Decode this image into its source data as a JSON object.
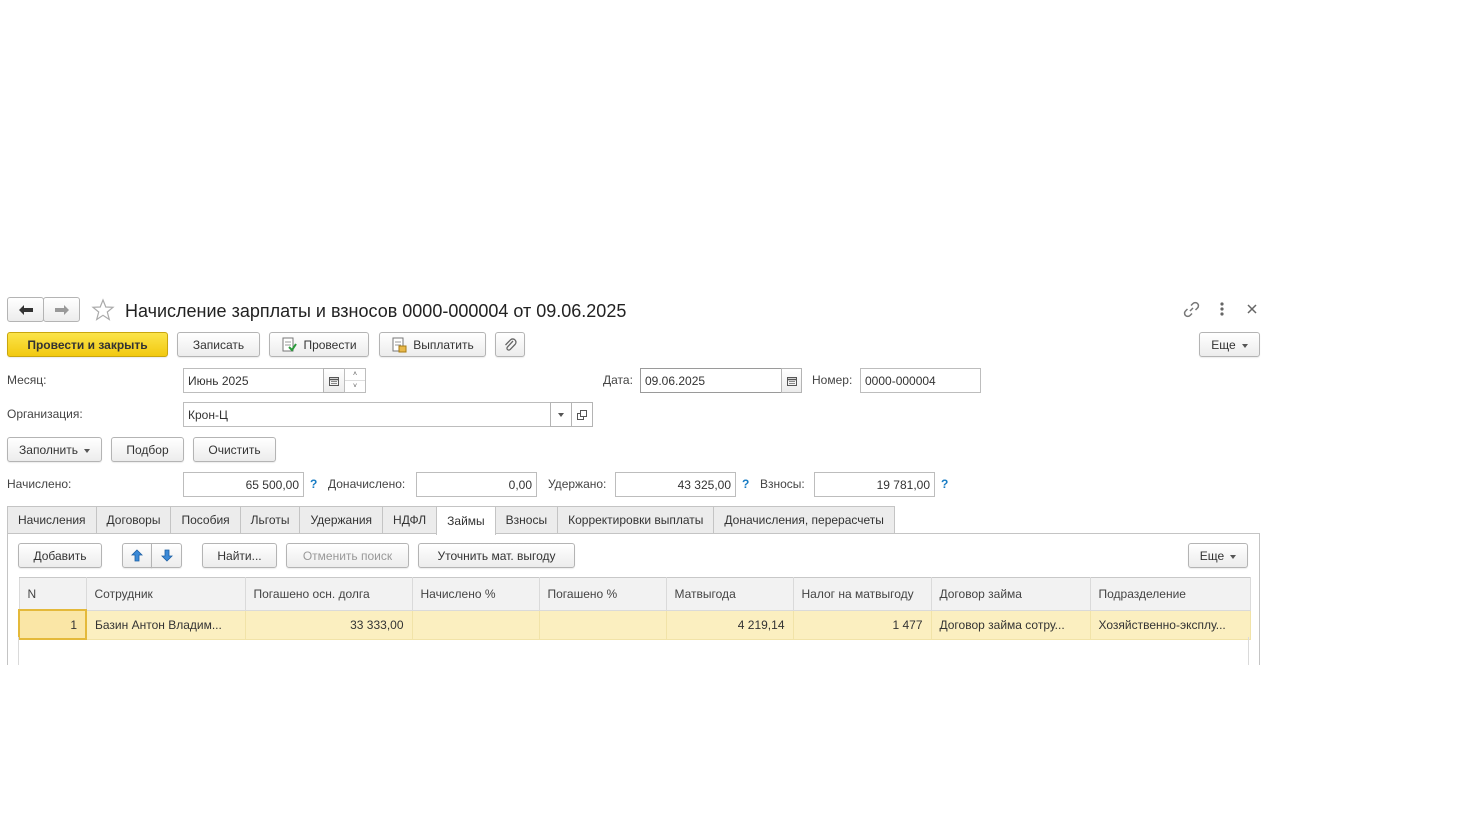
{
  "window": {
    "title": "Начисление зарплаты и взносов 0000-000004 от 09.06.2025",
    "nav_back_icon": "arrow-left-icon",
    "nav_forward_icon": "arrow-right-icon",
    "favorite_icon": "star-icon",
    "link_icon": "link-icon",
    "menu_icon": "more-vertical-icon",
    "close_icon": "close-icon"
  },
  "toolbar": {
    "post_close": "Провести и закрыть",
    "save": "Записать",
    "post": "Провести",
    "pay": "Выплатить",
    "attach_icon": "paperclip-icon",
    "more": "Еще"
  },
  "form": {
    "month_label": "Месяц:",
    "month_value": "Июнь 2025",
    "date_label": "Дата:",
    "date_value": "09.06.2025",
    "number_label": "Номер:",
    "number_value": "0000-000004",
    "org_label": "Организация:",
    "org_value": "Крон-Ц"
  },
  "actions": {
    "fill": "Заполнить",
    "pick": "Подбор",
    "clear": "Очистить"
  },
  "totals": {
    "accrued_label": "Начислено:",
    "accrued_value": "65 500,00",
    "extra_label": "Доначислено:",
    "extra_value": "0,00",
    "withheld_label": "Удержано:",
    "withheld_value": "43 325,00",
    "contrib_label": "Взносы:",
    "contrib_value": "19 781,00",
    "help": "?"
  },
  "tabs": [
    {
      "label": "Начисления"
    },
    {
      "label": "Договоры"
    },
    {
      "label": "Пособия"
    },
    {
      "label": "Льготы"
    },
    {
      "label": "Удержания"
    },
    {
      "label": "НДФЛ"
    },
    {
      "label": "Займы",
      "active": true
    },
    {
      "label": "Взносы"
    },
    {
      "label": "Корректировки выплаты"
    },
    {
      "label": "Доначисления, перерасчеты"
    }
  ],
  "table_toolbar": {
    "add": "Добавить",
    "find": "Найти...",
    "cancel_search": "Отменить поиск",
    "refine": "Уточнить мат. выгоду",
    "more": "Еще"
  },
  "table": {
    "columns": [
      "N",
      "Сотрудник",
      "Погашено осн. долга",
      "Начислено %",
      "Погашено %",
      "Матвыгода",
      "Налог на матвыгоду",
      "Договор займа",
      "Подразделение"
    ],
    "rows": [
      [
        "1",
        "Базин Антон Владим...",
        "33 333,00",
        "",
        "",
        "4 219,14",
        "1 477",
        "Договор займа сотру...",
        "Хозяйственно-эксплу..."
      ]
    ]
  }
}
